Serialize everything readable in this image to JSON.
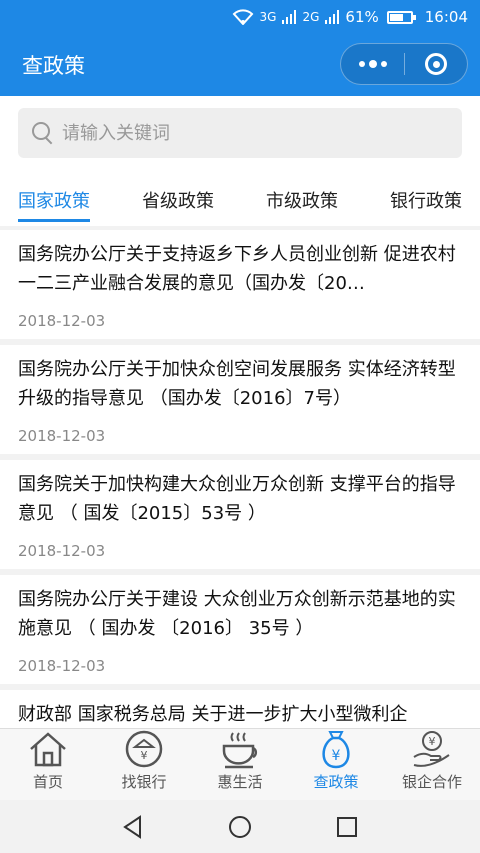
{
  "status": {
    "wifi": "wifi-icon",
    "signal1": "3G",
    "signal2": "2G",
    "battery": "61%",
    "battery_level": 61,
    "time": "16:04"
  },
  "nav": {
    "title": "查政策"
  },
  "search": {
    "placeholder": "请输入关键词"
  },
  "tabs": [
    {
      "label": "国家政策",
      "active": true
    },
    {
      "label": "省级政策",
      "active": false
    },
    {
      "label": "市级政策",
      "active": false
    },
    {
      "label": "银行政策",
      "active": false
    }
  ],
  "items": [
    {
      "title": "国务院办公厅关于支持返乡下乡人员创业创新 促进农村一二三产业融合发展的意见（国办发〔20…",
      "date": "2018-12-03"
    },
    {
      "title": "国务院办公厅关于加快众创空间发展服务 实体经济转型升级的指导意见 （国办发〔2016〕7号）",
      "date": "2018-12-03"
    },
    {
      "title": "国务院关于加快构建大众创业万众创新 支撑平台的指导意见 （ 国发〔2015〕53号 ）",
      "date": "2018-12-03"
    },
    {
      "title": "国务院办公厅关于建设 大众创业万众创新示范基地的实施意见 （ 国办发 〔2016〕 35号 ）",
      "date": "2018-12-03"
    },
    {
      "title": "财政部 国家税务总局 关于进一步扩大小型微利企",
      "date": ""
    }
  ],
  "tabbar": [
    {
      "label": "首页",
      "icon": "home-icon",
      "active": false
    },
    {
      "label": "找银行",
      "icon": "bank-icon",
      "active": false
    },
    {
      "label": "惠生活",
      "icon": "coffee-icon",
      "active": false
    },
    {
      "label": "查政策",
      "icon": "money-bag-icon",
      "active": true
    },
    {
      "label": "银企合作",
      "icon": "hand-coin-icon",
      "active": false
    }
  ],
  "colors": {
    "accent": "#1e88e5"
  }
}
